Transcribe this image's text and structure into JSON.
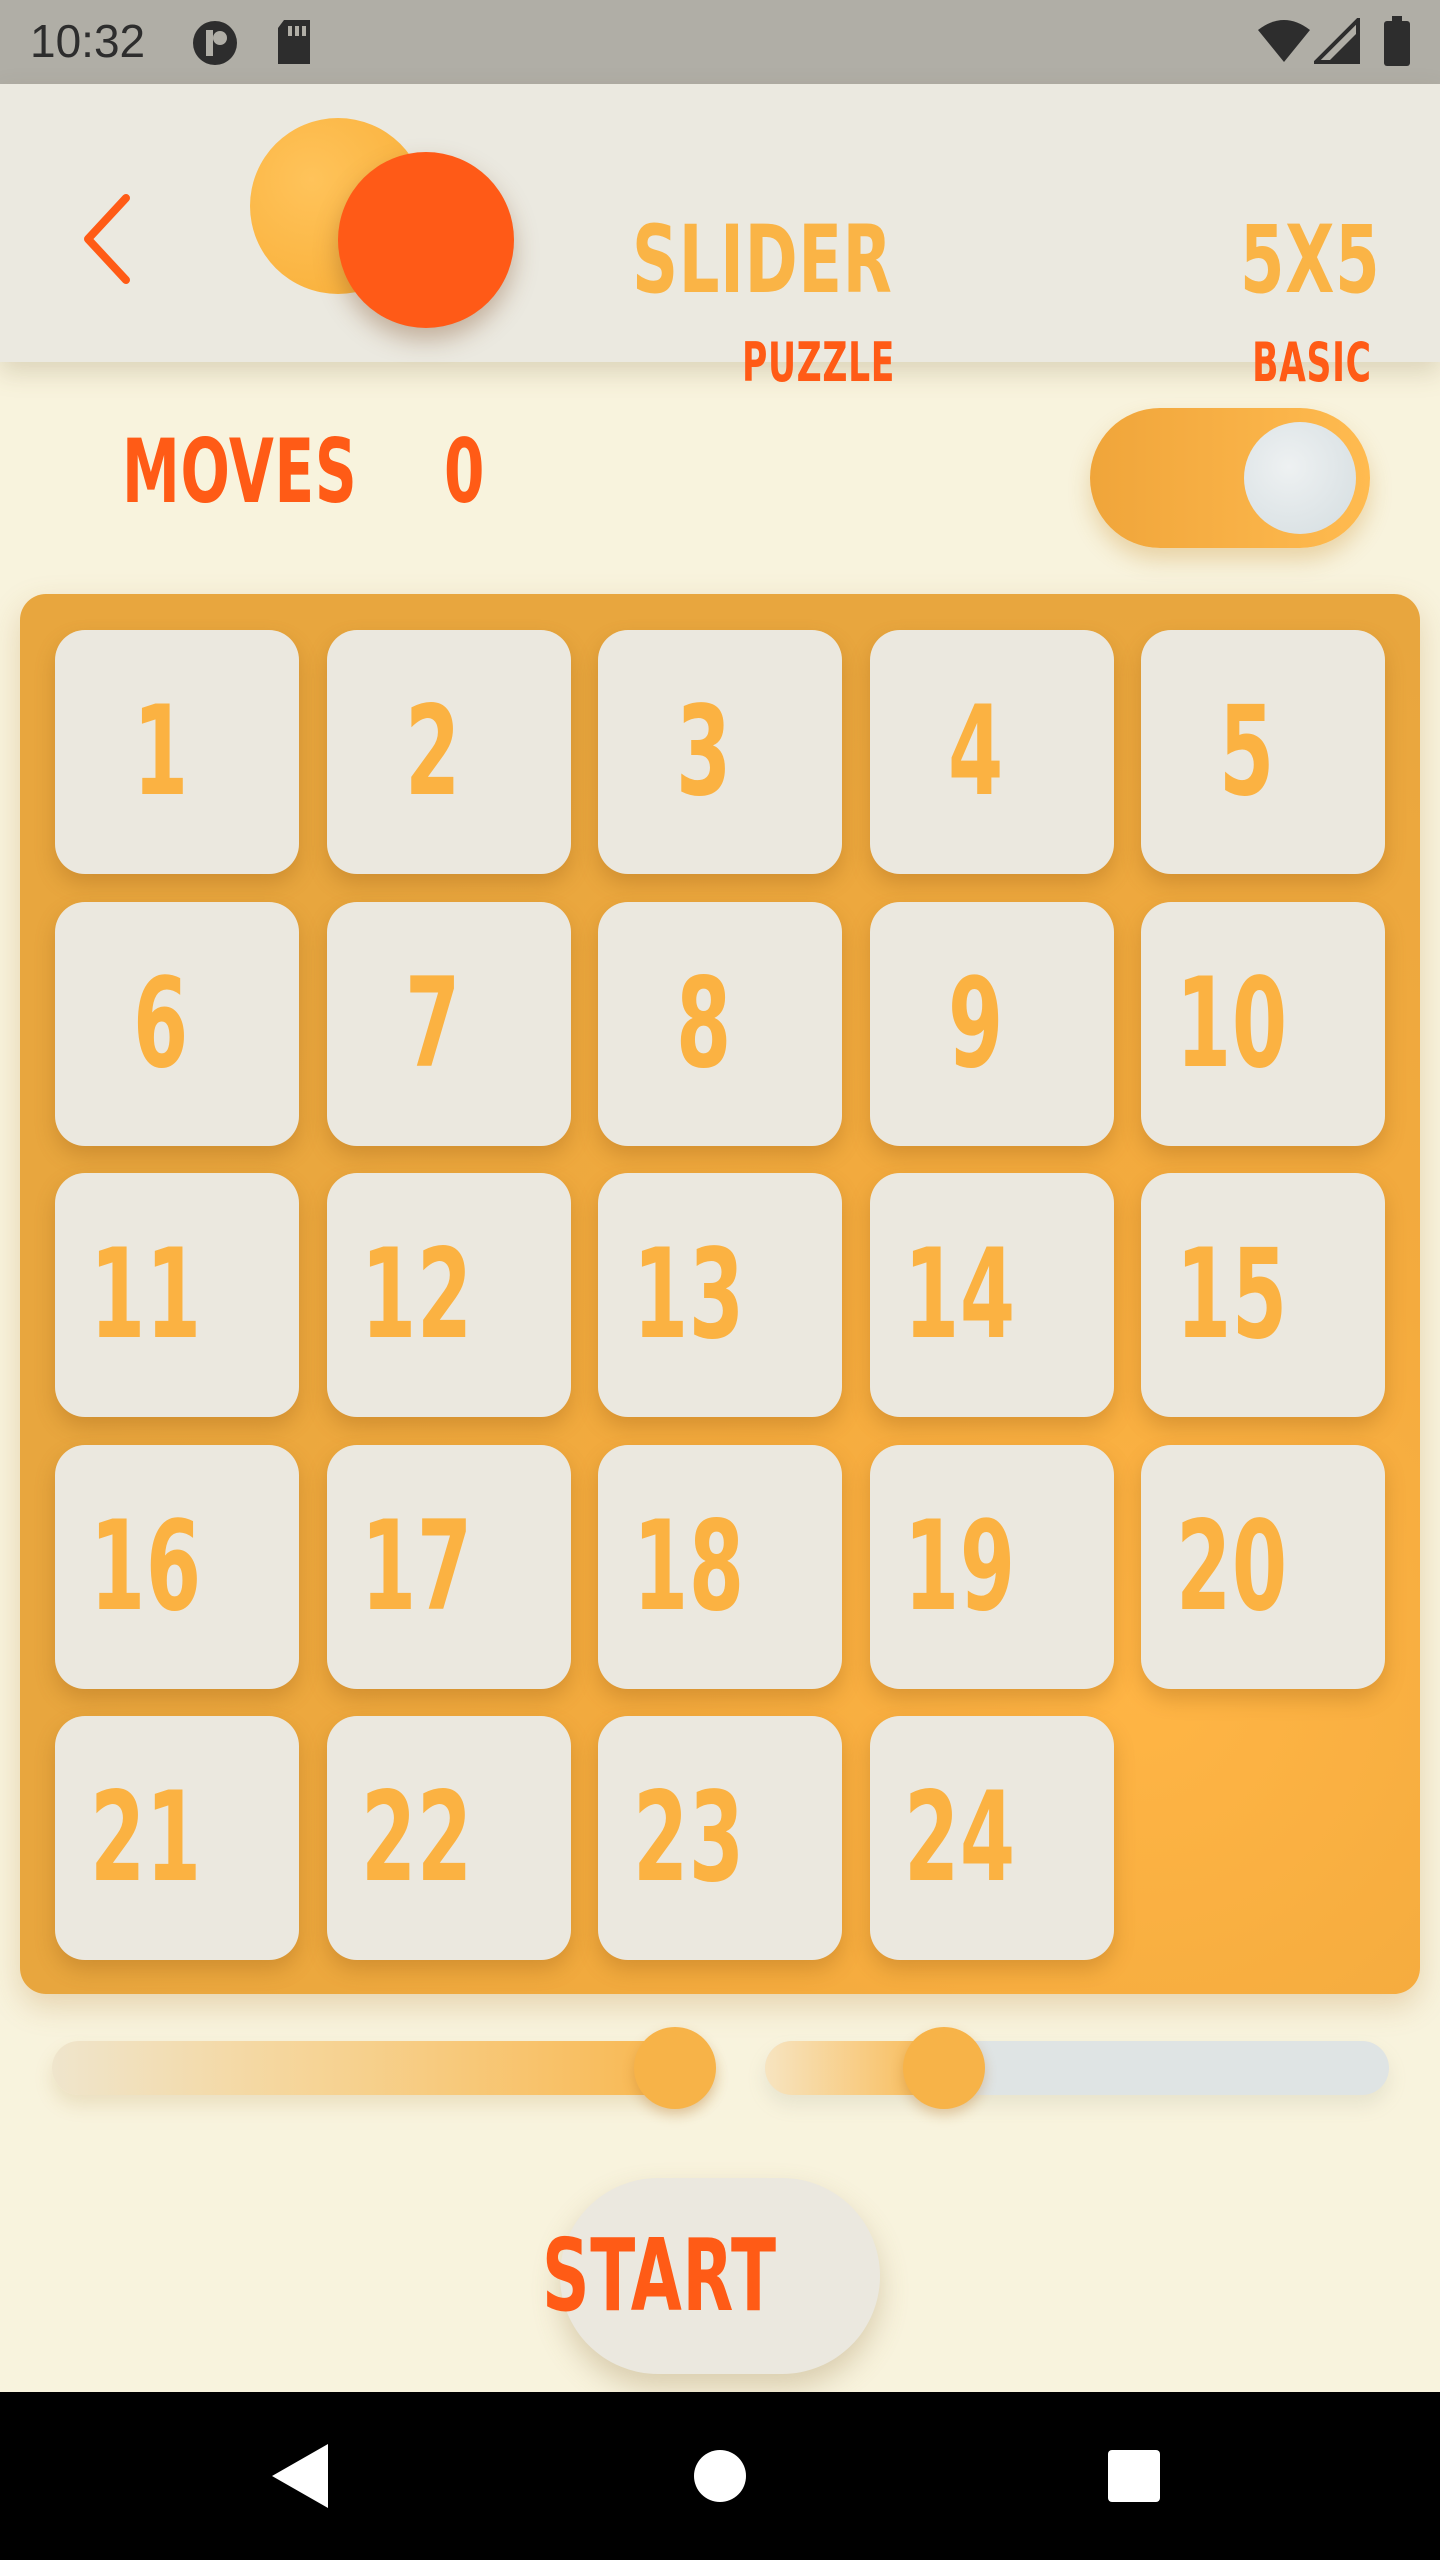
{
  "status_bar": {
    "time": "10:32",
    "icons": [
      "app-notification-icon",
      "sd-card-icon",
      "wifi-icon",
      "cell-signal-icon",
      "battery-icon"
    ]
  },
  "header": {
    "back_icon": "chevron-left-icon",
    "title": "SLIDER",
    "subtitle": "PUZZLE",
    "board_size": "5X5",
    "mode": "BASIC"
  },
  "game": {
    "moves_label": "MOVES",
    "moves_value": "0",
    "toggle_on": true
  },
  "board": {
    "rows": 5,
    "cols": 5,
    "tiles": [
      "1",
      "2",
      "3",
      "4",
      "5",
      "6",
      "7",
      "8",
      "9",
      "10",
      "11",
      "12",
      "13",
      "14",
      "15",
      "16",
      "17",
      "18",
      "19",
      "20",
      "21",
      "22",
      "23",
      "24",
      ""
    ]
  },
  "sliders": {
    "speed": {
      "value": 1.0
    },
    "difficulty": {
      "value": 0.2
    }
  },
  "start_label": "START",
  "nav": {
    "back": "back-triangle-icon",
    "home": "home-circle-icon",
    "recents": "recents-square-icon"
  },
  "colors": {
    "accent_orange": "#ff5b16",
    "accent_yellow": "#fab446",
    "board": "#e8a63e",
    "tile": "#ebe8df",
    "background": "#f8f3dd"
  }
}
